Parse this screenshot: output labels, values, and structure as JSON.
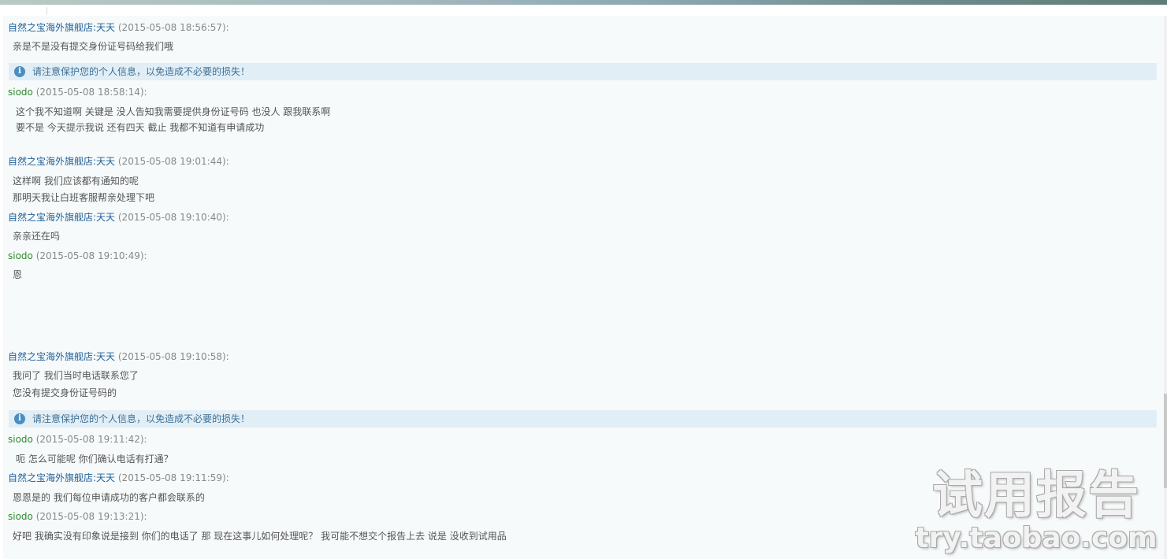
{
  "colors": {
    "seller_name": "#1f5f98",
    "buyer_name": "#2e8b2e",
    "timestamp": "#888888",
    "notice_bg": "#e2eef6",
    "notice_text": "#3d6f95"
  },
  "messages": [
    {
      "sender": "自然之宝海外旗舰店:天天",
      "time": "(2015-05-08 18:56:57):",
      "lines": [
        "亲是不是没有提交身份证号码给我们哦"
      ]
    },
    {
      "sender": "siodo",
      "time": "(2015-05-08 18:58:14):",
      "lines": [
        "这个我不知道啊 关键是 没人告知我需要提供身份证号码  也没人 跟我联系啊",
        "要不是 今天提示我说 还有四天 截止 我都不知道有申请成功"
      ]
    },
    {
      "sender": "自然之宝海外旗舰店:天天",
      "time": "(2015-05-08 19:01:44):",
      "lines": [
        "这样啊  我们应该都有通知的呢",
        "那明天我让白班客服帮亲处理下吧"
      ]
    },
    {
      "sender": "自然之宝海外旗舰店:天天",
      "time": "(2015-05-08 19:10:40):",
      "lines": [
        "亲亲还在吗"
      ]
    },
    {
      "sender": "siodo",
      "time": "(2015-05-08 19:10:49):",
      "lines": [
        "恩"
      ]
    },
    {
      "sender": "自然之宝海外旗舰店:天天",
      "time": "(2015-05-08 19:10:58):",
      "lines": [
        "我问了 我们当时电话联系您了",
        "您没有提交身份证号码的"
      ]
    },
    {
      "sender": "siodo",
      "time": "(2015-05-08 19:11:42):",
      "lines": [
        "呃 怎么可能呢  你们确认电话有打通？"
      ]
    },
    {
      "sender": "自然之宝海外旗舰店:天天",
      "time": "(2015-05-08 19:11:59):",
      "lines": [
        "恩恩是的 我们每位申请成功的客户都会联系的"
      ]
    },
    {
      "sender": "siodo",
      "time": "(2015-05-08 19:13:21):",
      "lines": [
        "好吧 我确实没有印象说是接到 你们的电话了  那 现在这事儿如何处理呢？ 我可能不想交个报告上去 说是 没收到试用品"
      ]
    }
  ],
  "notices": [
    {
      "text": "请注意保护您的个人信息，以免造成不必要的损失！",
      "icon": "info-icon"
    },
    {
      "text": "请注意保护您的个人信息，以免造成不必要的损失！",
      "icon": "info-icon"
    }
  ],
  "watermark": {
    "title": "试用报告",
    "url": "try.taobao.com"
  }
}
